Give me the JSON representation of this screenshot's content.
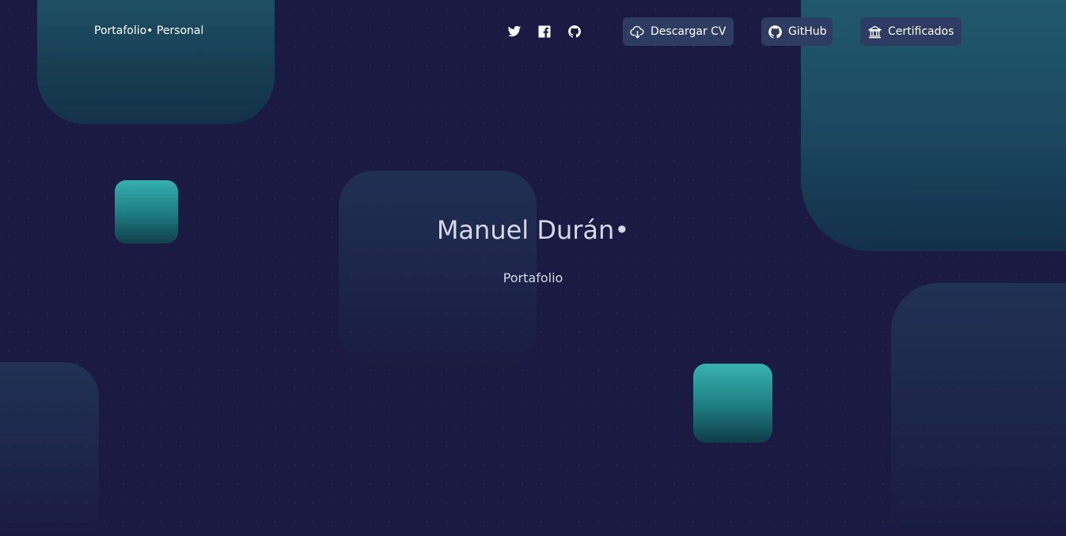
{
  "header": {
    "brand": "Portafolio• Personal"
  },
  "social": [
    {
      "name": "twitter",
      "icon": "twitter-icon"
    },
    {
      "name": "facebook",
      "icon": "facebook-icon"
    },
    {
      "name": "github",
      "icon": "github-icon"
    }
  ],
  "nav": {
    "download_cv": {
      "label": "Descargar CV",
      "icon": "cloud-download-icon"
    },
    "github": {
      "label": "GitHub",
      "icon": "github-icon"
    },
    "certificates": {
      "label": "Certificados",
      "icon": "institution-icon"
    }
  },
  "hero": {
    "title": "Manuel Durán•",
    "subtitle": "Portafolio"
  },
  "colors": {
    "background": "#1a1a42",
    "button_bg": "#2e3c64",
    "teal_accent": "#35b0b0",
    "text": "#ffffff",
    "hero_text": "#d7d7e6"
  }
}
